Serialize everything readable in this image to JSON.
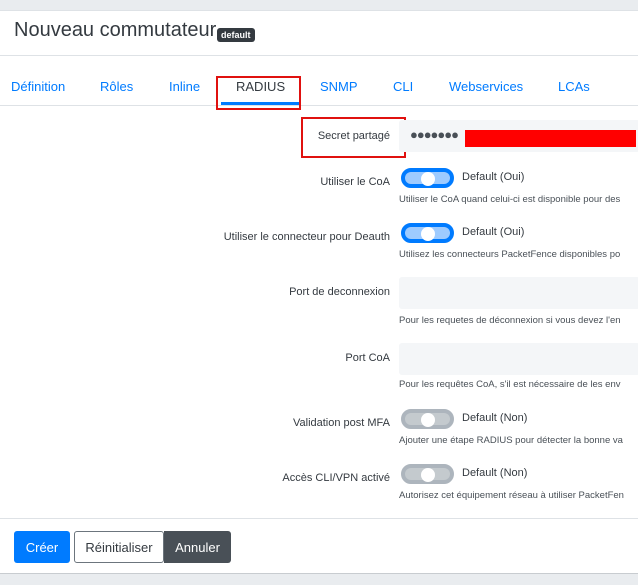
{
  "header": {
    "title": "Nouveau commutateur",
    "badge": "default"
  },
  "tabs": [
    {
      "label": "Définition"
    },
    {
      "label": "Rôles"
    },
    {
      "label": "Inline"
    },
    {
      "label": "RADIUS"
    },
    {
      "label": "SNMP"
    },
    {
      "label": "CLI"
    },
    {
      "label": "Webservices"
    },
    {
      "label": "LCAs"
    }
  ],
  "active_tab": "RADIUS",
  "form": {
    "secret": {
      "label": "Secret partagé",
      "masked_value": "●●●●●●●"
    },
    "coa": {
      "label": "Utiliser le CoA",
      "state": "on",
      "toggle_text": "Default (Oui)",
      "help": "Utiliser le CoA quand celui-ci est disponible pour des"
    },
    "deauth": {
      "label": "Utiliser le connecteur pour Deauth",
      "state": "on",
      "toggle_text": "Default (Oui)",
      "help": "Utilisez les connecteurs PacketFence disponibles po"
    },
    "disconnect_port": {
      "label": "Port de deconnexion",
      "value": "",
      "help": "Pour les requetes de déconnexion si vous devez l'en"
    },
    "coa_port": {
      "label": "Port CoA",
      "value": "",
      "help": "Pour les requêtes CoA, s'il est nécessaire de les env"
    },
    "mfa": {
      "label": "Validation post MFA",
      "state": "off",
      "toggle_text": "Default (Non)",
      "help": "Ajouter une étape RADIUS pour détecter la bonne va"
    },
    "cli_vpn": {
      "label": "Accès CLI/VPN activé",
      "state": "off",
      "toggle_text": "Default (Non)",
      "help": "Autorisez cet équipement réseau à utiliser PacketFen"
    }
  },
  "footer": {
    "create_label": "Créer",
    "reset_label": "Réinitialiser",
    "cancel_label": "Annuler"
  },
  "colors": {
    "accent": "#007bff",
    "annotation": "#e0110f",
    "redaction": "#ff0000"
  }
}
